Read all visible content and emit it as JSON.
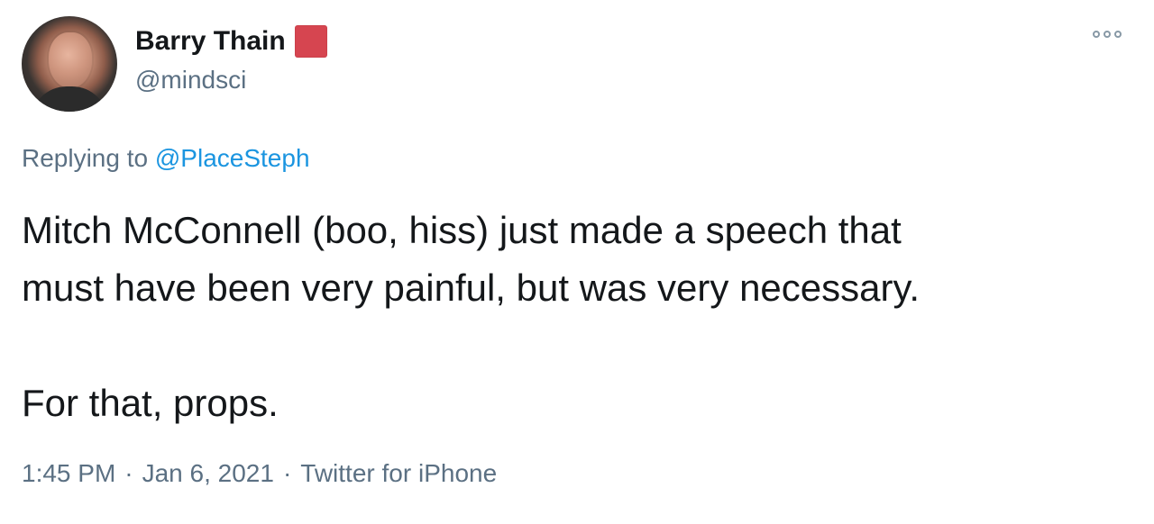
{
  "user": {
    "display_name": "Barry Thain",
    "handle": "@mindsci",
    "badge_color": "#d64550",
    "avatar_icon": "profile-photo"
  },
  "reply": {
    "prefix": "Replying to ",
    "mention": "@PlaceSteph"
  },
  "tweet": {
    "line1": "Mitch McConnell (boo, hiss) just made a speech that",
    "line2": "must have been very painful, but was very necessary.",
    "line3": "For that, props."
  },
  "meta": {
    "time": "1:45 PM",
    "separator": "·",
    "date": "Jan 6, 2021",
    "source": "Twitter for iPhone"
  },
  "icons": {
    "more": "more-options-icon"
  },
  "colors": {
    "text": "#14171a",
    "secondary": "#5b7083",
    "link": "#1b95e0"
  }
}
